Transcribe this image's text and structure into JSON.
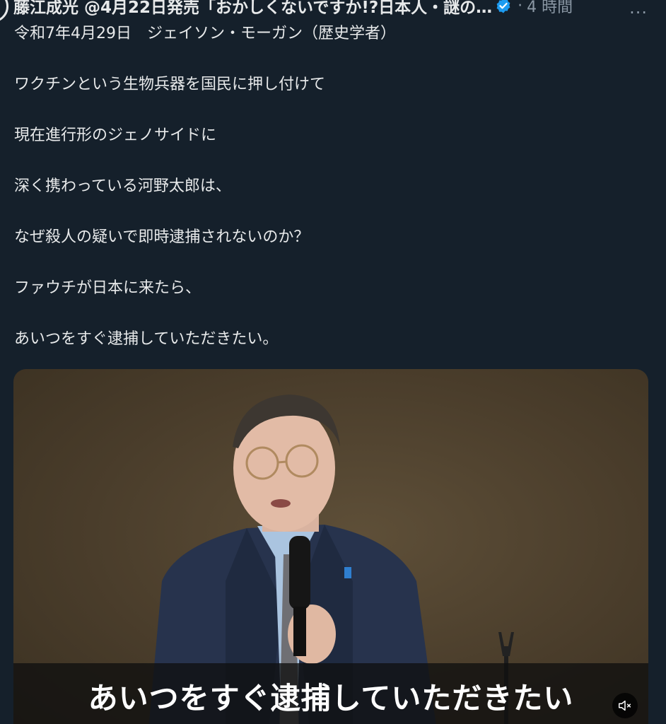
{
  "tweet": {
    "author_name": "藤江成光 @4月22日発売「おかしくないですか!?日本人・謎の…",
    "separator": "·",
    "timestamp": "4 時間",
    "more_label": "···",
    "lines": [
      "令和7年4月29日　ジェイソン・モーガン（歴史学者）",
      "",
      "ワクチンという生物兵器を国民に押し付けて",
      "",
      "現在進行形のジェノサイドに",
      "",
      "深く携わっている河野太郎は、",
      "",
      "なぜ殺人の疑いで即時逮捕されないのか？",
      "",
      "ファウチが日本に来たら、",
      "",
      "あいつをすぐ逮捕していただきたい。"
    ]
  },
  "media": {
    "caption": "あいつをすぐ逮捕していただきたい",
    "mute_icon": "speaker-muted-icon"
  },
  "colors": {
    "background": "#15202b",
    "text": "#e7e9ea",
    "muted": "#8b98a5",
    "verified": "#1d9bf0"
  }
}
